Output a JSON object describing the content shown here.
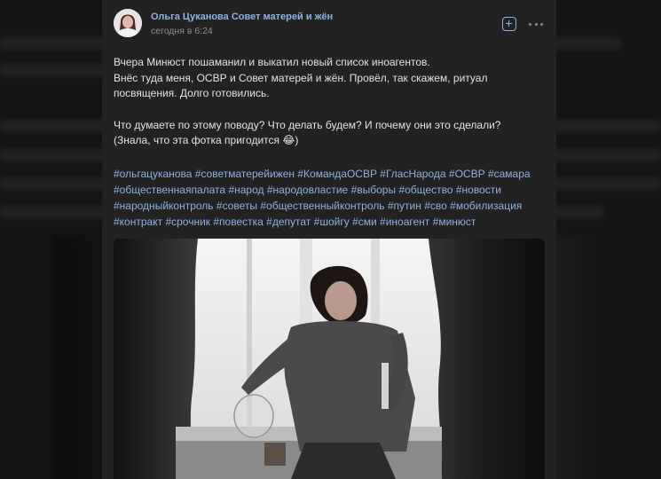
{
  "post": {
    "author": "Ольга Цуканова Совет матерей и жён",
    "time": "сегодня в 6:24",
    "text_lines": [
      "Вчера Минюст пошаманил и выкатил новый список иноагентов.",
      "Внёс туда меня, ОСВР и Совет матерей и жён. Провёл, так скажем, ритуал",
      "посвящения. Долго готовились.",
      "Что думаете по этому поводу? Что делать будем? И почему они это сделали?",
      "(Знала, что эта фотка пригодится 😂)"
    ],
    "hashtags": [
      [
        "#ольгацуканова",
        "#советматерейижен",
        "#КомандаОСВР",
        "#ГласНарода",
        "#ОСВР",
        "#самара"
      ],
      [
        "#общественнаяпалата",
        "#народ",
        "#народовластие",
        "#выборы",
        "#общество",
        "#новости"
      ],
      [
        "#народныйконтроль",
        "#советы",
        "#общественныйконтроль",
        "#путин",
        "#сво",
        "#мобилизация"
      ],
      [
        "#контракт",
        "#срочник",
        "#повестка",
        "#депутат",
        "#шойгу",
        "#сми",
        "#иноагент",
        "#минюст"
      ]
    ]
  },
  "icons": {
    "add": "add-square-icon",
    "more": "more-dots-icon"
  },
  "colors": {
    "link": "#8fb1e3",
    "card_bg": "#222222",
    "text": "#e1e3e6",
    "muted": "#8d8d8d"
  }
}
